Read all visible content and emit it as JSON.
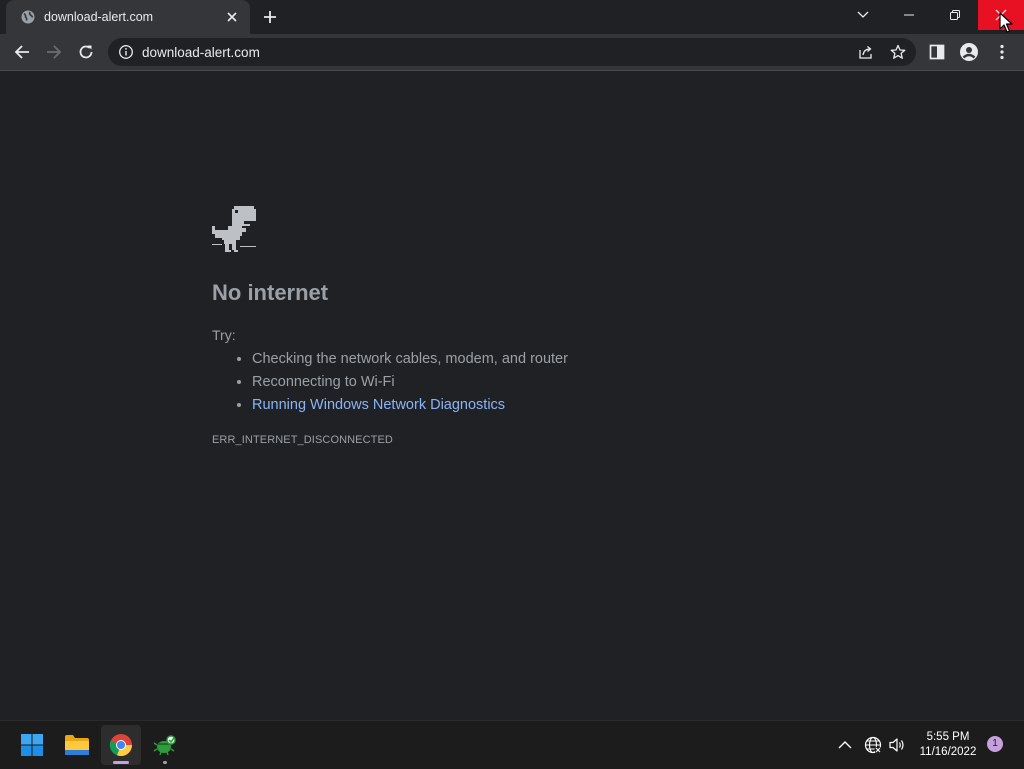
{
  "browser": {
    "tab": {
      "title": "download-alert.com",
      "favicon": "globe-icon",
      "close_icon": "close-icon"
    },
    "new_tab_icon": "plus-icon",
    "window_controls": [
      "tab-search-chevron-icon",
      "minimize-icon",
      "restore-icon",
      "close-icon"
    ],
    "toolbar": {
      "back_icon": "arrow-left-icon",
      "forward_icon": "arrow-right-icon",
      "reload_icon": "reload-icon",
      "site_info_icon": "info-icon",
      "url": "download-alert.com",
      "share_icon": "share-icon",
      "bookmark_icon": "star-icon",
      "side_panel_icon": "side-panel-icon",
      "profile_icon": "person-icon",
      "menu_icon": "kebab-menu-icon"
    }
  },
  "error_page": {
    "icon": "dinosaur-icon",
    "title": "No internet",
    "try_label": "Try:",
    "suggestions": [
      "Checking the network cables, modem, and router",
      "Reconnecting to Wi-Fi"
    ],
    "diagnostics_link": "Running Windows Network Diagnostics",
    "error_code": "ERR_INTERNET_DISCONNECTED"
  },
  "taskbar": {
    "apps": [
      "windows-start-icon",
      "file-explorer-icon",
      "chrome-icon",
      "bug-app-icon"
    ],
    "tray": [
      "chevron-up-icon",
      "network-globe-icon",
      "speaker-icon"
    ],
    "time": "5:55 PM",
    "date": "11/16/2022",
    "notification_count": "1"
  },
  "colors": {
    "page_bg": "#202124",
    "toolbar_bg": "#35363a",
    "text_secondary": "#9aa0a6",
    "link": "#8ab4f8",
    "close_hover": "#e81123"
  }
}
